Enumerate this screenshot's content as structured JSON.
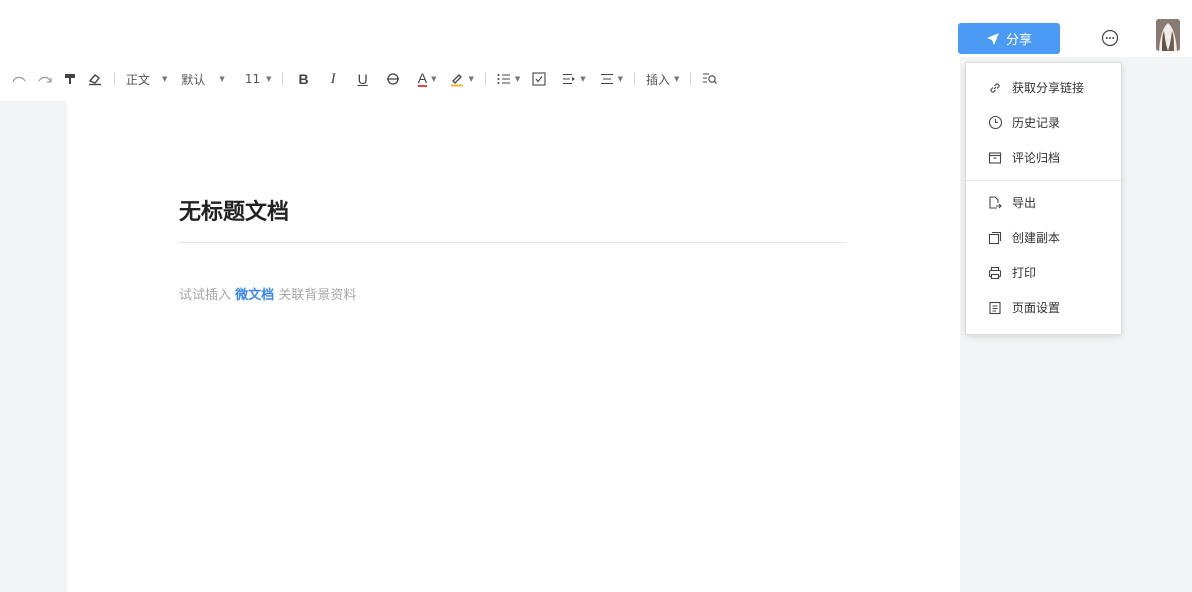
{
  "header": {
    "share_label": "分享",
    "share_color": "#4b9bf5"
  },
  "toolbar": {
    "paragraph_style": "正文",
    "font_family": "默认",
    "font_size": "11",
    "bold_label": "B",
    "italic_label": "I",
    "underline_label": "U",
    "font_color_label": "A",
    "insert_label": "插入"
  },
  "document": {
    "title": "无标题文档",
    "hint_prefix": "试试插入",
    "hint_link": "微文档",
    "hint_suffix": "关联背景资料"
  },
  "more_menu": {
    "items": [
      {
        "label": "获取分享链接",
        "icon": "link-icon"
      },
      {
        "label": "历史记录",
        "icon": "clock-icon"
      },
      {
        "label": "评论归档",
        "icon": "archive-icon"
      },
      {
        "label": "导出",
        "icon": "export-icon"
      },
      {
        "label": "创建副本",
        "icon": "copy-icon"
      },
      {
        "label": "打印",
        "icon": "printer-icon"
      },
      {
        "label": "页面设置",
        "icon": "page-settings-icon"
      }
    ]
  }
}
